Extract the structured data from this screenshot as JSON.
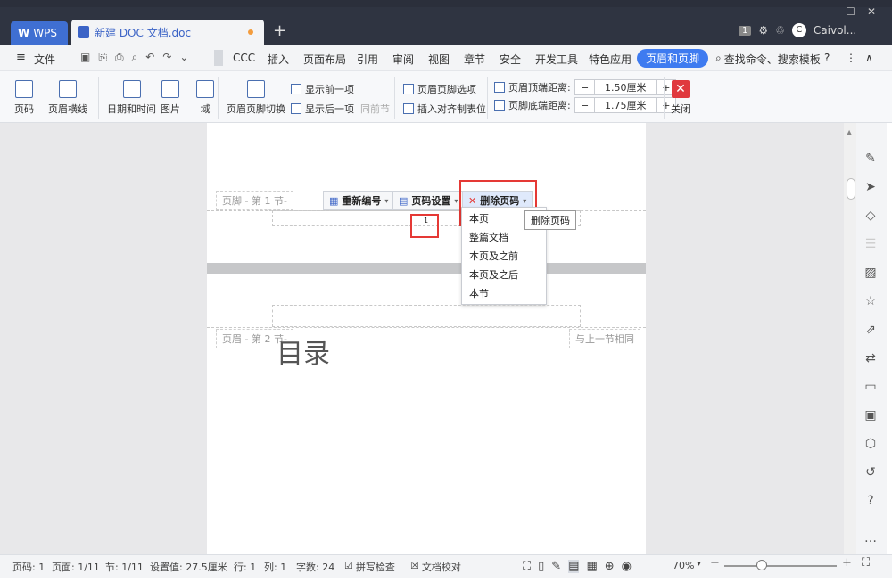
{
  "titlebar": {
    "app_tab": "WPS",
    "doc_tab": "新建 DOC 文档.doc",
    "new_tab": "+",
    "badge": "1",
    "user": "Caivol..."
  },
  "menu": {
    "file": "文件",
    "items": [
      "CCC",
      "插入",
      "页面布局",
      "引用",
      "审阅",
      "视图",
      "章节",
      "安全",
      "开发工具",
      "特色应用"
    ],
    "active": "页眉和页脚",
    "search": "查找命令、搜索模板"
  },
  "ribbon": {
    "page_number": "页码",
    "header_line": "页眉横线",
    "date_time": "日期和时间",
    "picture": "图片",
    "field": "域",
    "switch": "页眉页脚切换",
    "show_prev": "显示前一项",
    "show_next": "显示后一项",
    "same_as_prev": "同前节",
    "hf_options": "页眉页脚选项",
    "insert_align_tab": "插入对齐制表位",
    "header_top_label": "页眉顶端距离:",
    "header_top_value": "1.50厘米",
    "footer_bottom_label": "页脚底端距离:",
    "footer_bottom_value": "1.75厘米",
    "close": "关闭",
    "minus": "−",
    "plus": "+"
  },
  "document": {
    "footer_label": "页脚 - 第 1 节-",
    "renumber": "重新编号",
    "page_setting": "页码设置",
    "delete_page_number": "删除页码",
    "page_num_value": "1",
    "header_label": "页眉 - 第 2 节-",
    "same_as_prev_section": "与上一节相同",
    "toc_title": "目录",
    "dropdown": [
      "本页",
      "整篇文档",
      "本页及之前",
      "本页及之后",
      "本节"
    ],
    "tooltip": "删除页码"
  },
  "statusbar": {
    "page_code": "页码: 1",
    "page": "页面: 1/11",
    "section": "节: 1/11",
    "setting": "设置值: 27.5厘米",
    "row": "行: 1",
    "col": "列: 1",
    "words": "字数: 24",
    "spell": "拼写检查",
    "proof": "文档校对",
    "zoom": "70%"
  },
  "colors": {
    "titlebar": "#2f3441",
    "accent": "#3e7bf0",
    "highlight_red": "#e53935"
  }
}
